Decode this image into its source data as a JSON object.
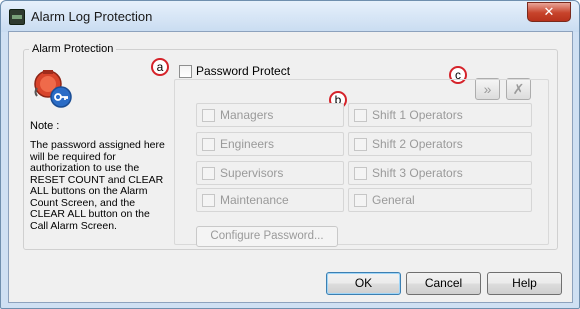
{
  "window": {
    "title": "Alarm Log Protection",
    "close_glyph": "✕"
  },
  "group": {
    "label": "Alarm Protection"
  },
  "note": {
    "label": "Note :",
    "text": "The password assigned here will be required for authorization to use the RESET COUNT and CLEAR ALL buttons on the Alarm Count Screen, and the CLEAR ALL button on the Call Alarm Screen."
  },
  "password_protect": {
    "label": "Password Protect",
    "checked": false
  },
  "tools": {
    "select_all_icon": "double-chevron-down-icon",
    "clear_icon": "clear-x-icon"
  },
  "roles_left": [
    "Managers",
    "Engineers",
    "Supervisors",
    "Maintenance"
  ],
  "roles_right": [
    "Shift 1 Operators",
    "Shift 2 Operators",
    "Shift 3 Operators",
    "General"
  ],
  "configure_button": "Configure Password...",
  "buttons": {
    "ok": "OK",
    "cancel": "Cancel",
    "help": "Help"
  },
  "callouts": {
    "a": "a",
    "b": "b",
    "c": "c"
  },
  "colors": {
    "callout_border": "#d5232a",
    "close_button": "#c7432b",
    "disabled_text": "#9a9a9a"
  }
}
